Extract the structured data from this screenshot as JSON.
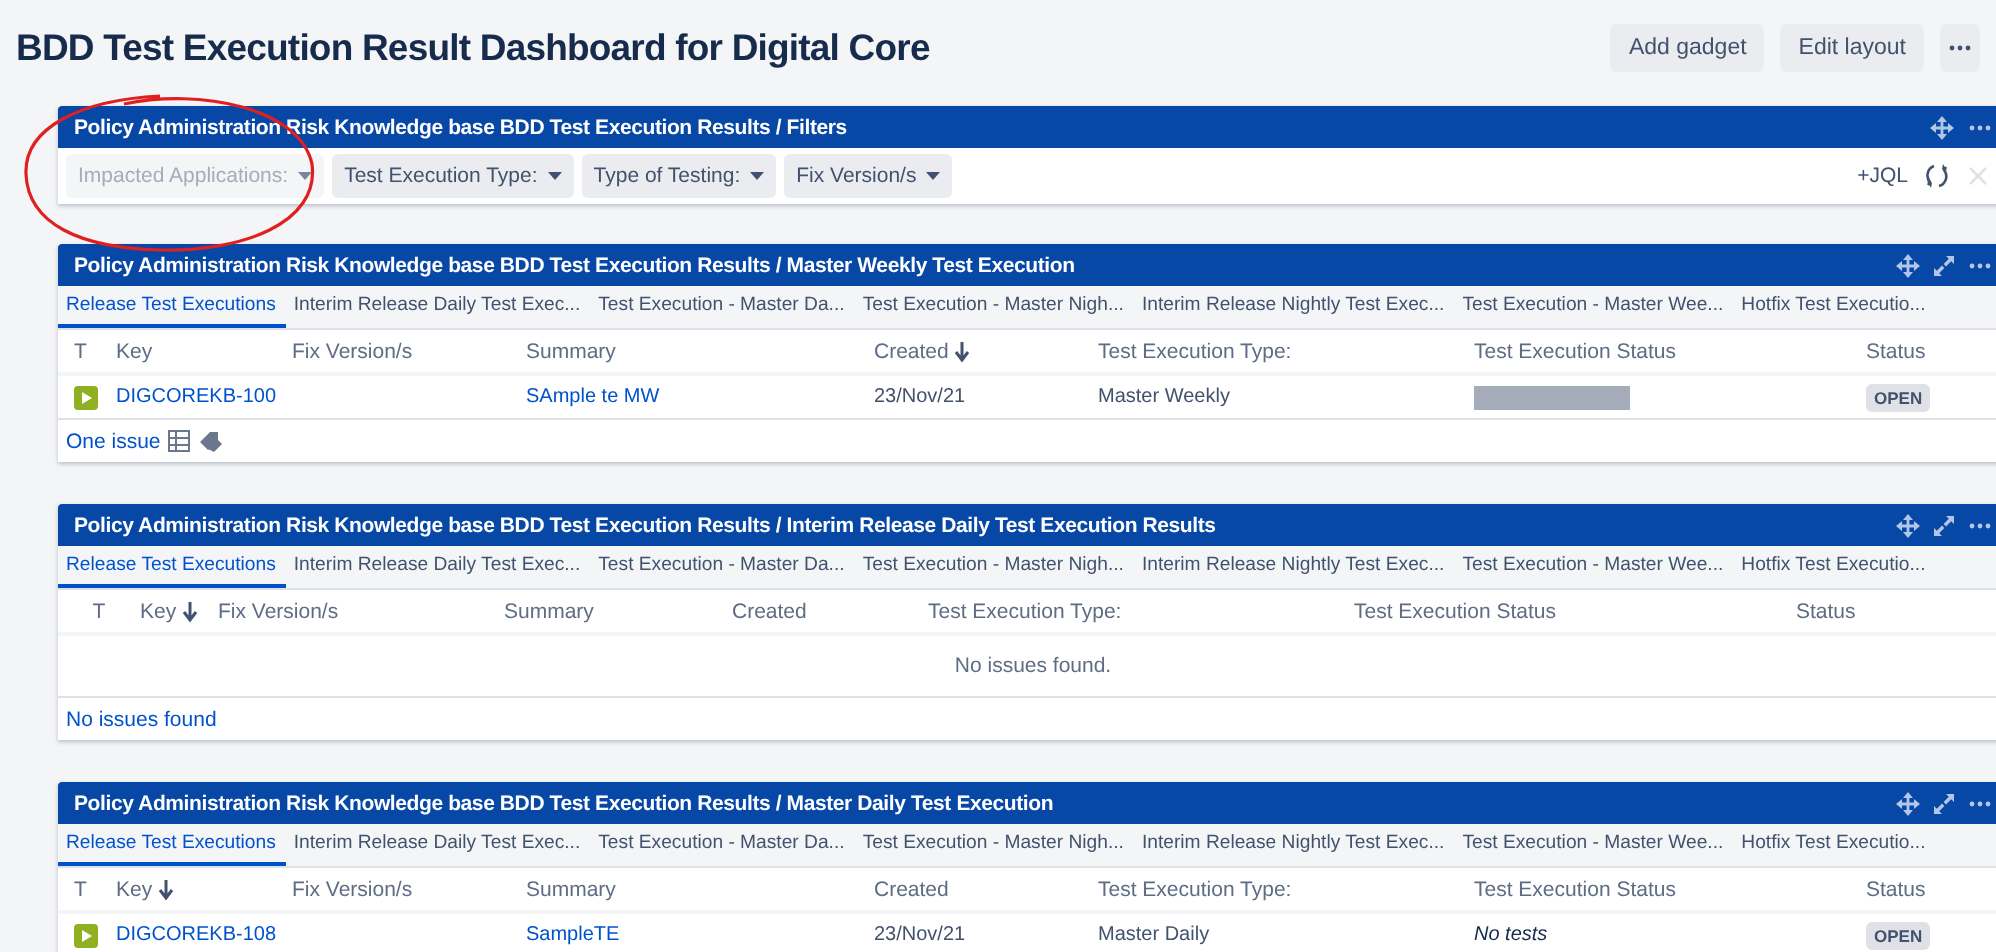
{
  "page_title": "BDD Test Execution Result Dashboard for Digital Core",
  "header_buttons": [
    "Add gadget",
    "Edit layout"
  ],
  "filter_gadget": {
    "title": "Policy Administration Risk Knowledge base BDD Test Execution Results / Filters",
    "filters": [
      {
        "label": "Impacted Applications:",
        "disabled": true
      },
      {
        "label": "Test Execution Type:",
        "disabled": false
      },
      {
        "label": "Type of Testing:",
        "disabled": false
      },
      {
        "label": "Fix Version/s",
        "disabled": false
      }
    ],
    "jql_button": "+JQL",
    "clear_disabled": true
  },
  "gadgets": [
    {
      "title": "Policy Administration Risk Knowledge base BDD Test Execution Results / Master Weekly Test Execution",
      "tabs": [
        {
          "label": "Release Test Executions",
          "selected": true
        },
        {
          "label": "Interim Release Daily Test Exec...",
          "selected": false
        },
        {
          "label": "Test Execution - Master Da...",
          "selected": false
        },
        {
          "label": "Test Execution - Master Nigh...",
          "selected": false
        },
        {
          "label": "Interim Release Nightly Test Exec...",
          "selected": false
        },
        {
          "label": "Test Execution - Master Wee...",
          "selected": false
        },
        {
          "label": "Hotfix Test Executio...",
          "selected": false
        }
      ],
      "columns": [
        {
          "label": "T",
          "sorted": false
        },
        {
          "label": "Key",
          "sorted": false
        },
        {
          "label": "Fix Version/s",
          "sorted": false
        },
        {
          "label": "Summary",
          "sorted": false
        },
        {
          "label": "Created",
          "sorted": true
        },
        {
          "label": "Test Execution Type:",
          "sorted": false
        },
        {
          "label": "Test Execution Status",
          "sorted": false
        },
        {
          "label": "Status",
          "sorted": false
        }
      ],
      "rows": [
        {
          "key": "DIGCOREKB-100",
          "summary": "SAmple te MW",
          "created": "23/Nov/21",
          "execution_type": "Master Weekly",
          "execution_status": {
            "kind": "bar"
          },
          "status": "OPEN"
        }
      ],
      "footer": "One issue",
      "footer_icons": true
    },
    {
      "title": "Policy Administration Risk Knowledge base BDD Test Execution Results / Interim Release Daily Test Execution Results",
      "tabs": [
        {
          "label": "Release Test Executions",
          "selected": true
        },
        {
          "label": "Interim Release Daily Test Exec...",
          "selected": false
        },
        {
          "label": "Test Execution - Master Da...",
          "selected": false
        },
        {
          "label": "Test Execution - Master Nigh...",
          "selected": false
        },
        {
          "label": "Interim Release Nightly Test Exec...",
          "selected": false
        },
        {
          "label": "Test Execution - Master Wee...",
          "selected": false
        },
        {
          "label": "Hotfix Test Executio...",
          "selected": false
        }
      ],
      "columns": [
        {
          "label": "T",
          "sorted": false
        },
        {
          "label": "Key",
          "sorted": true
        },
        {
          "label": "Fix Version/s",
          "sorted": false
        },
        {
          "label": "Summary",
          "sorted": false
        },
        {
          "label": "Created",
          "sorted": false
        },
        {
          "label": "Test Execution Type:",
          "sorted": false
        },
        {
          "label": "Test Execution Status",
          "sorted": false
        },
        {
          "label": "Status",
          "sorted": false
        }
      ],
      "empty_message": "No issues found.",
      "footer": "No issues found",
      "footer_icons": false
    },
    {
      "title": "Policy Administration Risk Knowledge base BDD Test Execution Results / Master Daily Test Execution",
      "tabs": [
        {
          "label": "Release Test Executions",
          "selected": true
        },
        {
          "label": "Interim Release Daily Test Exec...",
          "selected": false
        },
        {
          "label": "Test Execution - Master Da...",
          "selected": false
        },
        {
          "label": "Test Execution - Master Nigh...",
          "selected": false
        },
        {
          "label": "Interim Release Nightly Test Exec...",
          "selected": false
        },
        {
          "label": "Test Execution - Master Wee...",
          "selected": false
        },
        {
          "label": "Hotfix Test Executio...",
          "selected": false
        }
      ],
      "columns": [
        {
          "label": "T",
          "sorted": false
        },
        {
          "label": "Key",
          "sorted": true
        },
        {
          "label": "Fix Version/s",
          "sorted": false
        },
        {
          "label": "Summary",
          "sorted": false
        },
        {
          "label": "Created",
          "sorted": false
        },
        {
          "label": "Test Execution Type:",
          "sorted": false
        },
        {
          "label": "Test Execution Status",
          "sorted": false
        },
        {
          "label": "Status",
          "sorted": false
        }
      ],
      "rows": [
        {
          "key": "DIGCOREKB-108",
          "summary": "SampleTE",
          "created": "23/Nov/21",
          "execution_type": "Master Daily",
          "execution_status": {
            "kind": "text",
            "text": "No tests"
          },
          "status": "OPEN"
        }
      ]
    }
  ]
}
